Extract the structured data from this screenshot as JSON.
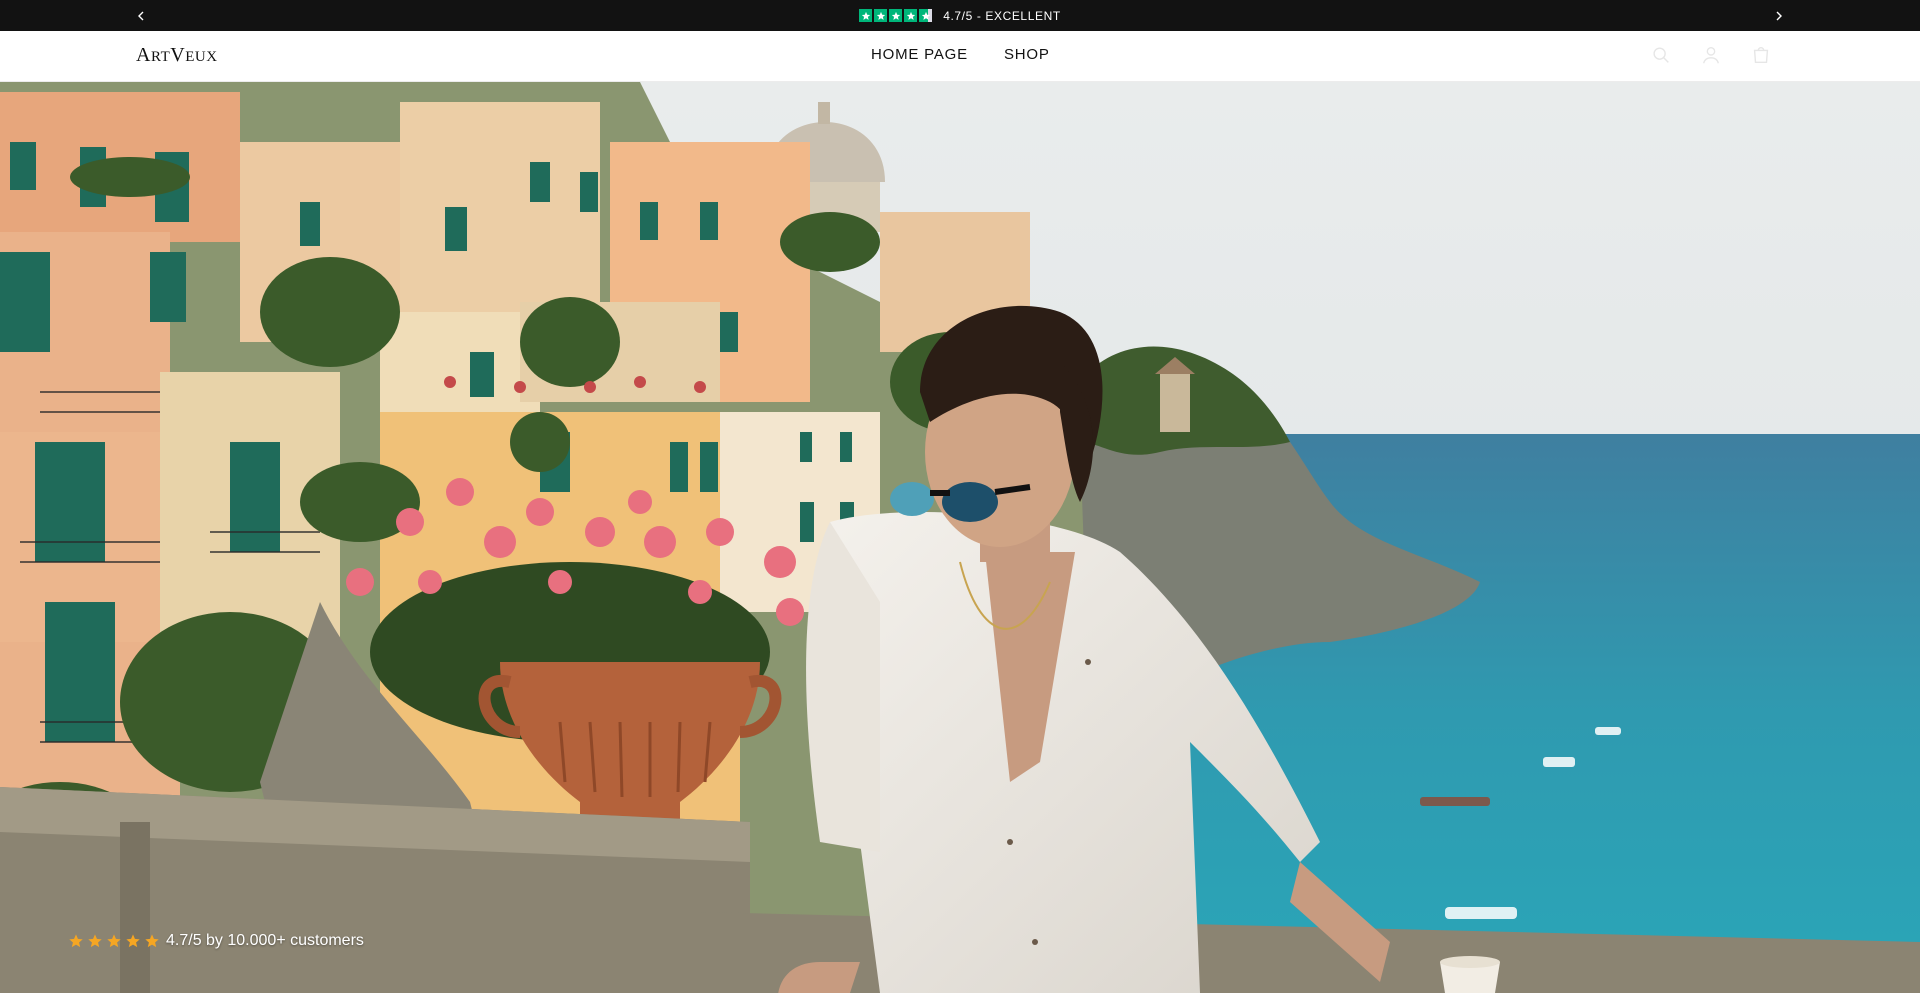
{
  "announcement": {
    "rating_text": "4.7/5 - EXCELLENT",
    "prev_icon": "chevron-left-icon",
    "next_icon": "chevron-right-icon",
    "trustpilot_color": "#00b67a"
  },
  "header": {
    "logo": "ArtVeux",
    "nav": [
      {
        "label": "HOME PAGE"
      },
      {
        "label": "SHOP"
      }
    ],
    "icons": [
      "search-icon",
      "account-icon",
      "cart-icon"
    ]
  },
  "hero": {
    "image_alt": "Man in white linen shirt and sunglasses on a coastal balcony",
    "rating": {
      "stars": 5,
      "star_color": "#f5a623",
      "text": "4.7/5 by 10.000+ customers"
    }
  }
}
